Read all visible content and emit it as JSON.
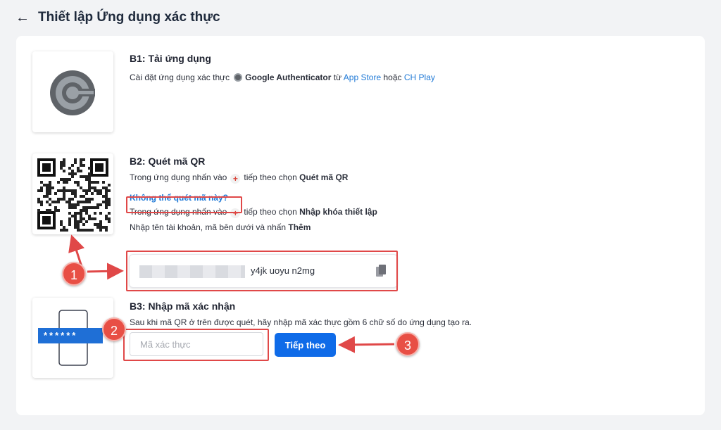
{
  "header": {
    "title": "Thiết lập Ứng dụng xác thực"
  },
  "step1": {
    "title": "B1: Tải ứng dụng",
    "desc_prefix": "Cài đặt ứng dụng xác thực",
    "app_name": "Google Authenticator",
    "from": "từ",
    "app_store": "App Store",
    "or": "hoặc",
    "ch_play": "CH Play"
  },
  "step2": {
    "title": "B2: Quét mã QR",
    "line1_prefix": "Trong ứng dụng nhấn vào",
    "line1_mid": "tiếp theo chọn",
    "line1_action": "Quét mã QR",
    "cant_scan": "Không thể quét mã này?",
    "line2_prefix": "Trong ứng dụng nhấn vào",
    "line2_mid": "tiếp theo chọn",
    "line2_action": "Nhập khóa thiết lập",
    "line3_prefix": "Nhập tên tài khoản, mã bên dưới và nhấn",
    "line3_action": "Thêm",
    "key_visible": "y4jk uoyu n2mg"
  },
  "step3": {
    "title": "B3: Nhập mã xác nhận",
    "desc": "Sau khi mã QR ở trên được quét, hãy nhập mã xác thực gồm 6 chữ số do ứng dụng tạo ra.",
    "input_placeholder": "Mã xác thực",
    "input_value": "",
    "submit_label": "Tiếp theo",
    "phone_mask": "******"
  },
  "annotations": {
    "badge1": "1",
    "badge2": "2",
    "badge3": "3"
  },
  "colors": {
    "accent": "#0f6be8",
    "link": "#1f79d6",
    "highlight": "#e04848"
  }
}
